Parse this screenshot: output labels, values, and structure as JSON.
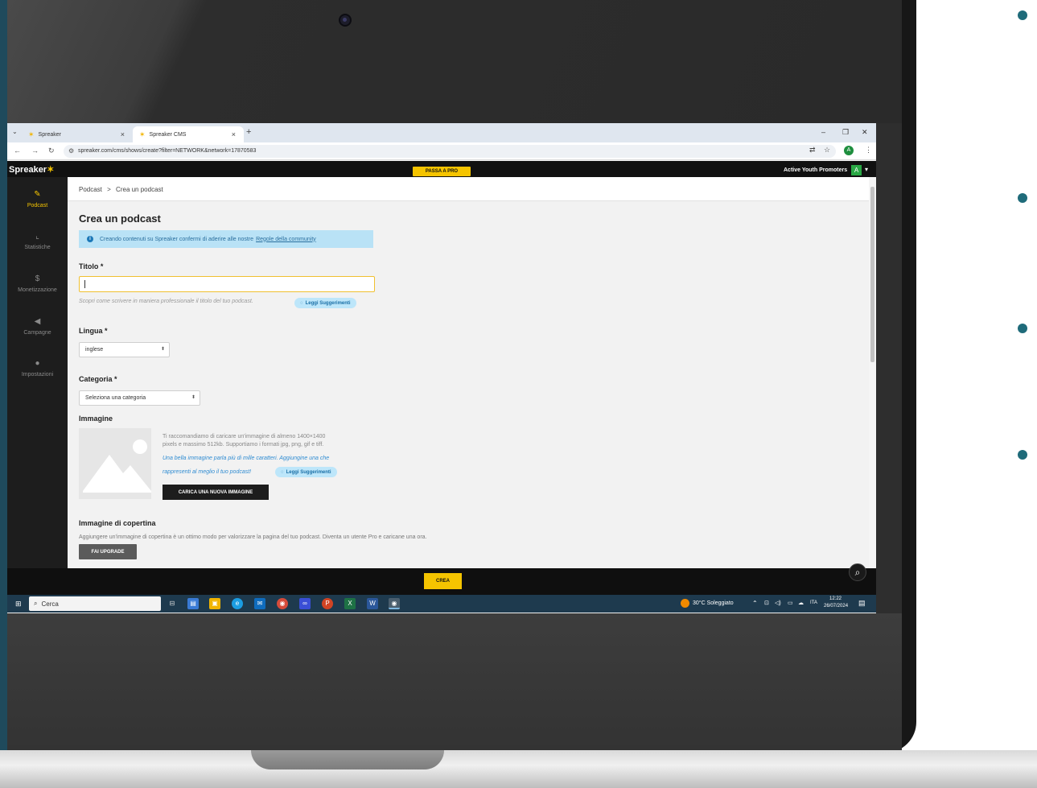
{
  "browser": {
    "tabs": [
      {
        "label": "Spreaker",
        "active": false
      },
      {
        "label": "Spreaker CMS",
        "active": true
      }
    ],
    "tab_close": "×",
    "new_tab": "+",
    "url": "spreaker.com/cms/shows/create?filter=NETWORK&network=17870583",
    "profile_initial": "A"
  },
  "app": {
    "logo": "Spreaker",
    "logo_star": "✶",
    "pro_button": "PASSA A PRO",
    "network_name": "Active Youth Promoters",
    "user_initial": "A",
    "accent_color": "#f5c400"
  },
  "sidebar": {
    "items": [
      {
        "label": "Podcast",
        "icon": "pencil-icon",
        "active": true
      },
      {
        "label": "Statistiche",
        "icon": "chart-icon",
        "active": false
      },
      {
        "label": "Monetizzazione",
        "icon": "dollar-icon",
        "active": false
      },
      {
        "label": "Campagne",
        "icon": "megaphone-icon",
        "active": false
      },
      {
        "label": "Impostazioni",
        "icon": "user-icon",
        "active": false
      }
    ]
  },
  "breadcrumb": {
    "root": "Podcast",
    "separator": ">",
    "current": "Crea un podcast"
  },
  "form": {
    "page_title": "Crea un podcast",
    "info_text": "Creando contenuti su Spreaker confermi di aderire alle nostre",
    "info_link": "Regole della community",
    "title_label": "Titolo *",
    "title_value": "",
    "title_hint": "Scopri come scrivere in maniera professionale il titolo del tuo podcast.",
    "suggestions_button": "Leggi Suggerimenti",
    "language_label": "Lingua *",
    "language_value": "inglese",
    "category_label": "Categoria *",
    "category_value": "Seleziona una categoria",
    "image_label": "Immagine",
    "image_desc_1": "Ti raccomandiamo di caricare un'immagine di almeno 1400×1400",
    "image_desc_2": "pixels e massimo 512kb. Supportiamo i formati jpg, png, gif e tiff.",
    "image_tip_1": "Una bella immagine parla più di mille caratteri. Aggiungine una che",
    "image_tip_2": "rappresenti al meglio il tuo podcast!",
    "upload_button": "CARICA UNA NUOVA IMMAGINE",
    "cover_label": "Immagine di copertina",
    "cover_desc": "Aggiungere un'immagine di copertina è un ottimo modo per valorizzare la pagina del tuo podcast. Diventa un utente Pro e caricane una ora.",
    "upgrade_button": "FAI UPGRADE",
    "create_button": "CREA"
  },
  "taskbar": {
    "search_placeholder": "Cerca",
    "weather": "30°C  Soleggiato",
    "language": "ITA",
    "time": "12:22",
    "date": "26/07/2024"
  }
}
